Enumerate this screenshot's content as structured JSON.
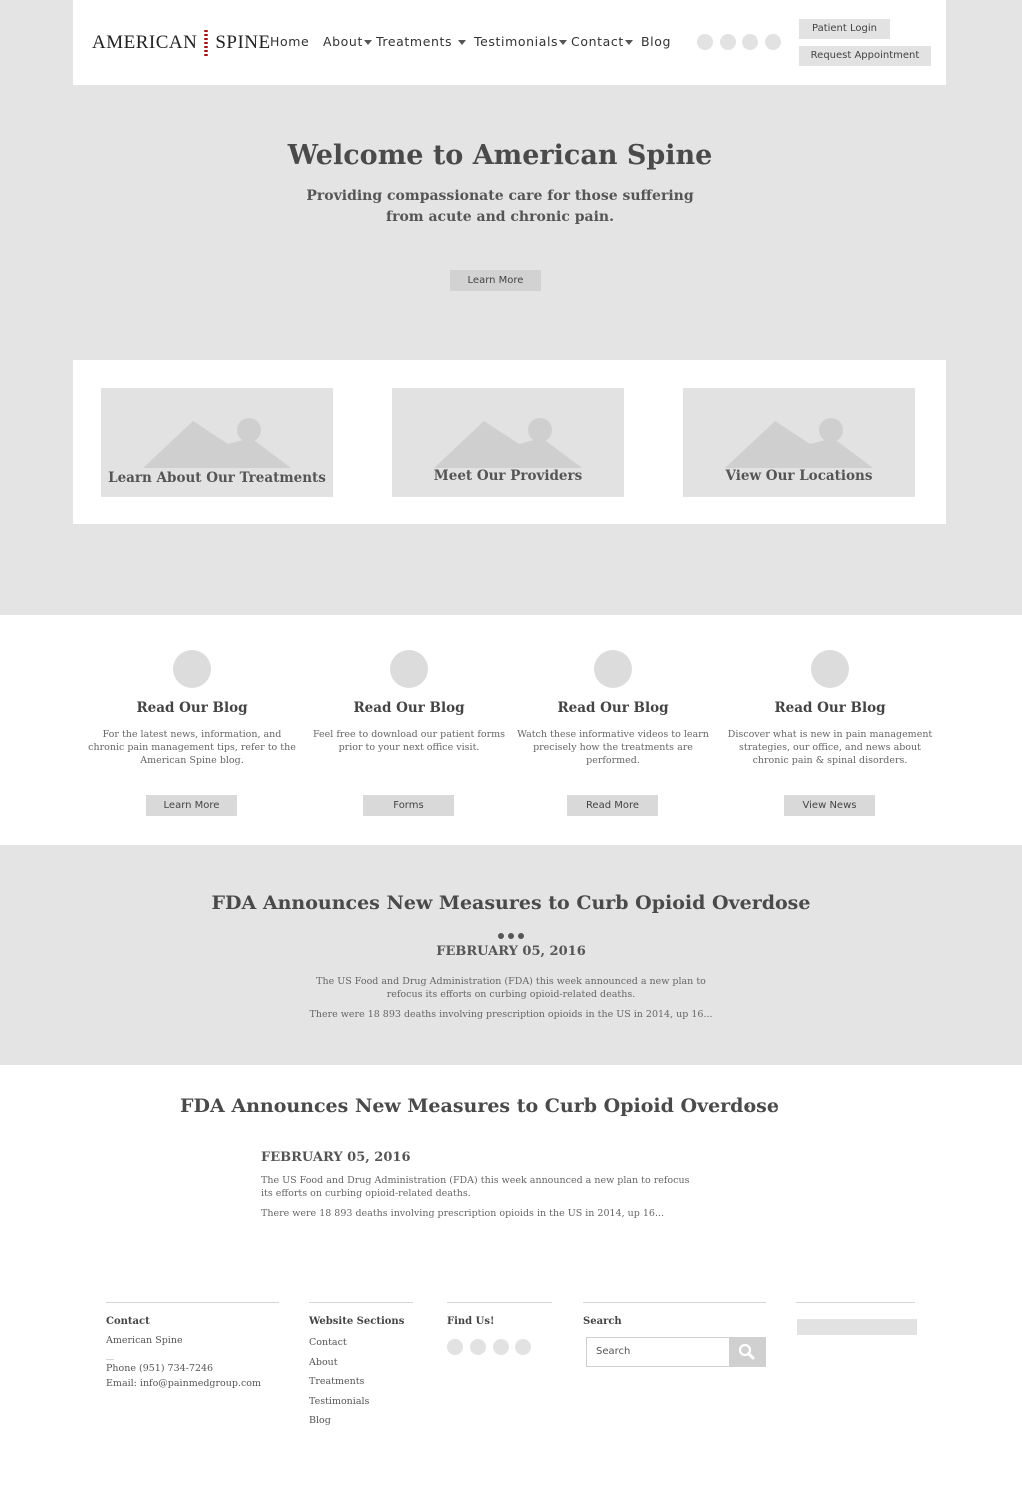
{
  "header": {
    "logo_left": "AMERICAN",
    "logo_right": "SPINE",
    "nav": [
      {
        "label": "Home",
        "dropdown": false
      },
      {
        "label": "About",
        "dropdown": true
      },
      {
        "label": "Treatments",
        "dropdown": true
      },
      {
        "label": "Testimonials",
        "dropdown": true
      },
      {
        "label": "Contact",
        "dropdown": true
      },
      {
        "label": "Blog",
        "dropdown": false
      }
    ],
    "patient_login": "Patient Login",
    "request_appointment": "Request Appointment"
  },
  "hero": {
    "title": "Welcome to American Spine",
    "subtitle_line1": "Providing compassionate care for those suffering",
    "subtitle_line2": "from acute and chronic pain.",
    "button": "Learn More"
  },
  "cards": [
    {
      "label": "Learn About Our Treatments"
    },
    {
      "label": "Meet Our Providers"
    },
    {
      "label": "View Our Locations"
    }
  ],
  "columns": [
    {
      "title": "Read Our Blog",
      "desc": "For the latest news, information, and chronic pain management tips, refer to the American Spine blog.",
      "button": "Learn More"
    },
    {
      "title": "Read Our Blog",
      "desc": "Feel free to download our patient forms prior to your next office visit.",
      "button": "Forms"
    },
    {
      "title": "Read Our Blog",
      "desc": "Watch these informative videos to learn precisely how the treatments are performed.",
      "button": "Read More"
    },
    {
      "title": "Read Our Blog",
      "desc": "Discover what is new in pain management strategies, our office, and news about chronic pain & spinal disorders.",
      "button": "View News"
    }
  ],
  "news_band": {
    "title": "FDA Announces New Measures to Curb Opioid Overdose",
    "date": "FEBRUARY 05, 2016",
    "para1": "The US Food and Drug Administration (FDA) this week announced a new plan to refocus its efforts on curbing opioid-related deaths.",
    "para2": "There were 18 893 deaths involving prescription opioids in the US in 2014, up 16..."
  },
  "news_slider": {
    "title": "FDA Announces New Measures to Curb Opioid Overdose",
    "prev_icon": "‹",
    "next_icon": "›",
    "date": "FEBRUARY 05, 2016",
    "para1": "The US Food and Drug Administration (FDA) this week announced a new plan to refocus its efforts on curbing opioid-related deaths.",
    "para2": "There were 18 893 deaths involving prescription opioids in the US in 2014, up 16..."
  },
  "footer": {
    "contact": {
      "heading": "Contact",
      "name": "American Spine",
      "phone": "Phone (951) 734-7246",
      "email": "Email: info@painmedgroup.com"
    },
    "sections": {
      "heading": "Website Sections",
      "links": [
        "Contact",
        "About",
        "Treatments",
        "Testimonials",
        "Blog"
      ]
    },
    "find_us": {
      "heading": "Find Us!"
    },
    "search": {
      "heading": "Search",
      "placeholder": "Search"
    }
  }
}
